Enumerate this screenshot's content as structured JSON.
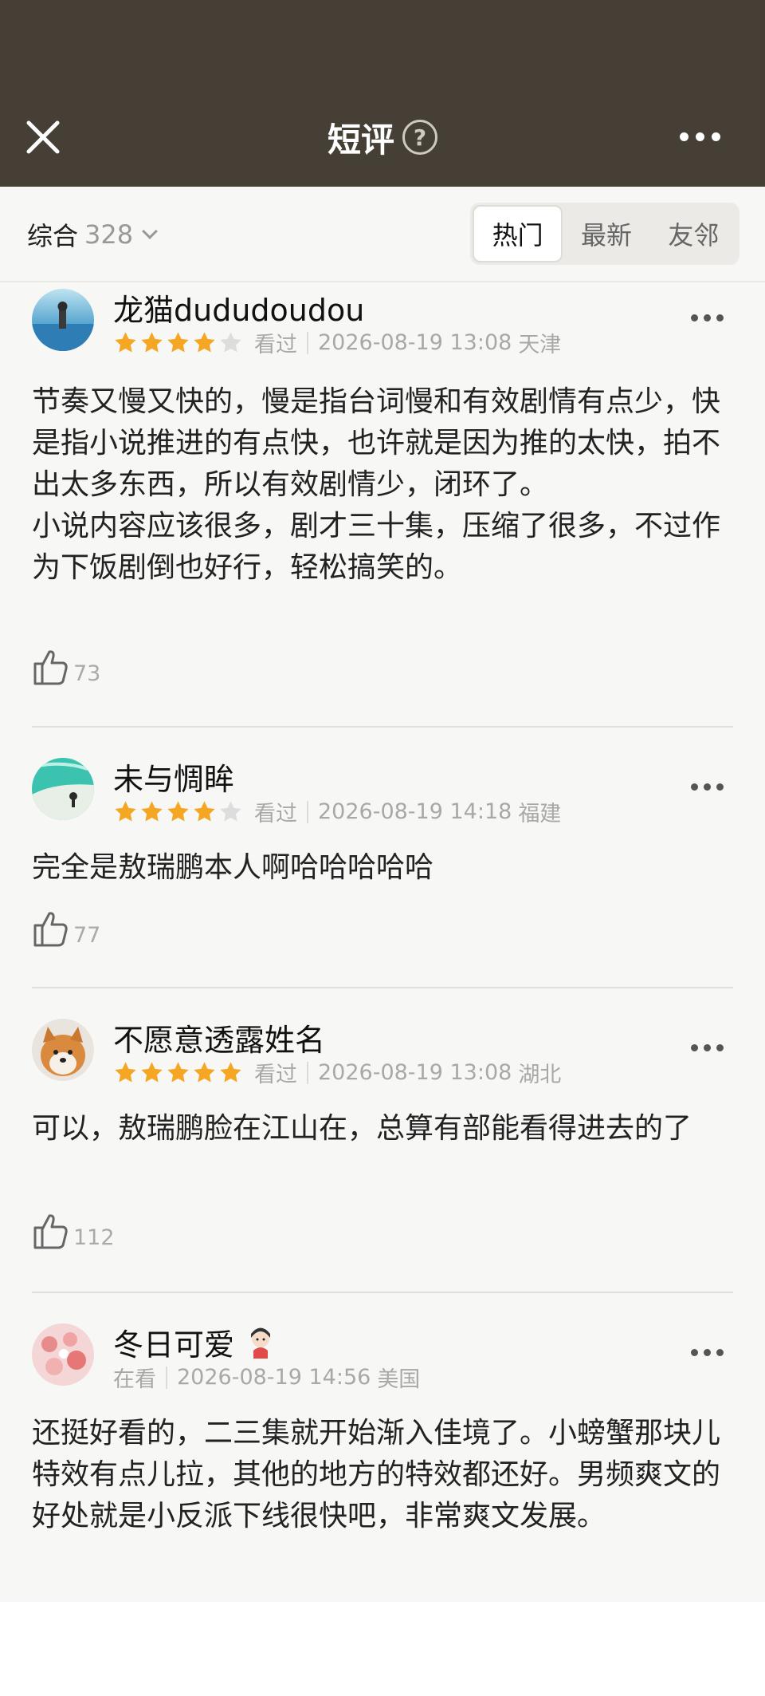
{
  "header": {
    "title": "短评",
    "help_icon": "question-circle-icon",
    "close_icon": "close-icon",
    "more_icon": "more-horizontal-icon"
  },
  "filter": {
    "sort_label": "综合",
    "sort_count": "328",
    "tabs": [
      {
        "label": "热门",
        "active": true
      },
      {
        "label": "最新",
        "active": false
      },
      {
        "label": "友邻",
        "active": false
      }
    ]
  },
  "colors": {
    "header_bg": "#453f35",
    "star_active": "#f5a623",
    "star_inactive": "#dddddd",
    "page_bg": "#f7f7f5"
  },
  "reviews": [
    {
      "user": "龙猫dududoudou",
      "rating": 4,
      "status": "看过",
      "time": "2026-08-19 13:08",
      "location": "天津",
      "text": "节奏又慢又快的，慢是指台词慢和有效剧情有点少，快是指小说推进的有点快，也许就是因为推的太快，拍不出太多东西，所以有效剧情少，闭环了。\n小说内容应该很多，剧才三十集，压缩了很多，不过作为下饭剧倒也好行，轻松搞笑的。",
      "likes": "73"
    },
    {
      "user": "未与惆眸",
      "rating": 4,
      "status": "看过",
      "time": "2026-08-19 14:18",
      "location": "福建",
      "text": "完全是敖瑞鹏本人啊哈哈哈哈哈",
      "likes": "77"
    },
    {
      "user": "不愿意透露姓名",
      "rating": 5,
      "status": "看过",
      "time": "2026-08-19 13:08",
      "location": "湖北",
      "text": "可以，敖瑞鹏脸在江山在，总算有部能看得进去的了",
      "likes": "112"
    },
    {
      "user": "冬日可爱",
      "rating": null,
      "status": "在看",
      "time": "2026-08-19 14:56",
      "location": "美国",
      "text": "还挺好看的，二三集就开始渐入佳境了。小螃蟹那块儿特效有点儿拉，其他的地方的特效都还好。男频爽文的好处就是小反派下线很快吧，非常爽文发展。",
      "likes": ""
    }
  ]
}
